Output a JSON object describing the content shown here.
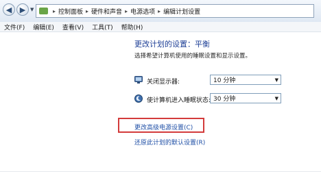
{
  "breadcrumb": {
    "items": [
      "控制面板",
      "硬件和声音",
      "电源选项",
      "编辑计划设置"
    ],
    "separator": "▸"
  },
  "menu": {
    "items": [
      "文件(F)",
      "编辑(E)",
      "查看(V)",
      "工具(T)",
      "帮助(H)"
    ]
  },
  "content": {
    "heading": "更改计划的设置：平衡",
    "subtext": "选择希望计算机使用的睡眠设置和显示设置。",
    "display_off": {
      "label": "关闭显示器:",
      "value": "10 分钟"
    },
    "sleep": {
      "label": "使计算机进入睡眠状态:",
      "value": "30 分钟"
    },
    "advanced_link": "更改高级电源设置(C)",
    "restore_link": "还原此计划的默认设置(R)"
  },
  "colors": {
    "accent": "#1e3f96",
    "link": "#1f4fa6",
    "highlight": "#d33a3a"
  }
}
